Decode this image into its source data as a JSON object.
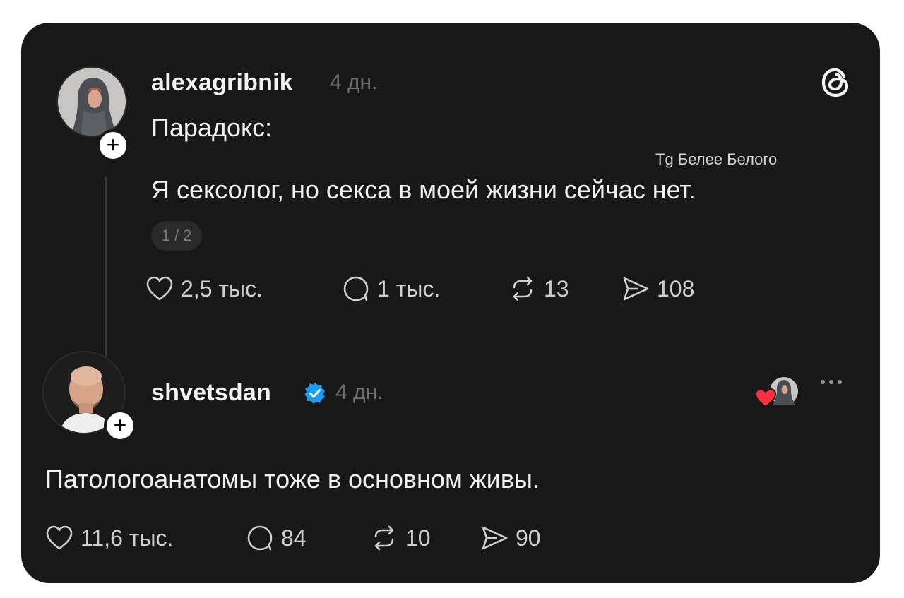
{
  "colors": {
    "card_bg": "#181818",
    "text_primary": "#f1f1f1",
    "text_muted": "#6f6f6f",
    "verified_blue": "#1d9bf0",
    "heart_red": "#ff3040"
  },
  "post": {
    "username": "alexagribnik",
    "time": "4 дн.",
    "line1": "Парадокс:",
    "line2": "Я сексолог, но секса в моей жизни сейчас нет.",
    "pager": "1 / 2",
    "actions": {
      "likes": "2,5 тыс.",
      "comments": "1 тыс.",
      "reposts": "13",
      "shares": "108"
    },
    "avatar_icon": "avatar-hooded-woman",
    "follow_icon": "plus-icon"
  },
  "reply": {
    "username": "shvetsdan",
    "time": "4 дн.",
    "text": "Патологоанатомы тоже в основном живы.",
    "actions": {
      "likes": "11,6 тыс.",
      "comments": "84",
      "reposts": "10",
      "shares": "90"
    },
    "avatar_icon": "avatar-bald-man",
    "follow_icon": "plus-icon"
  },
  "watermark": "Tg Белее Белого",
  "app_icon": "threads-logo-icon"
}
